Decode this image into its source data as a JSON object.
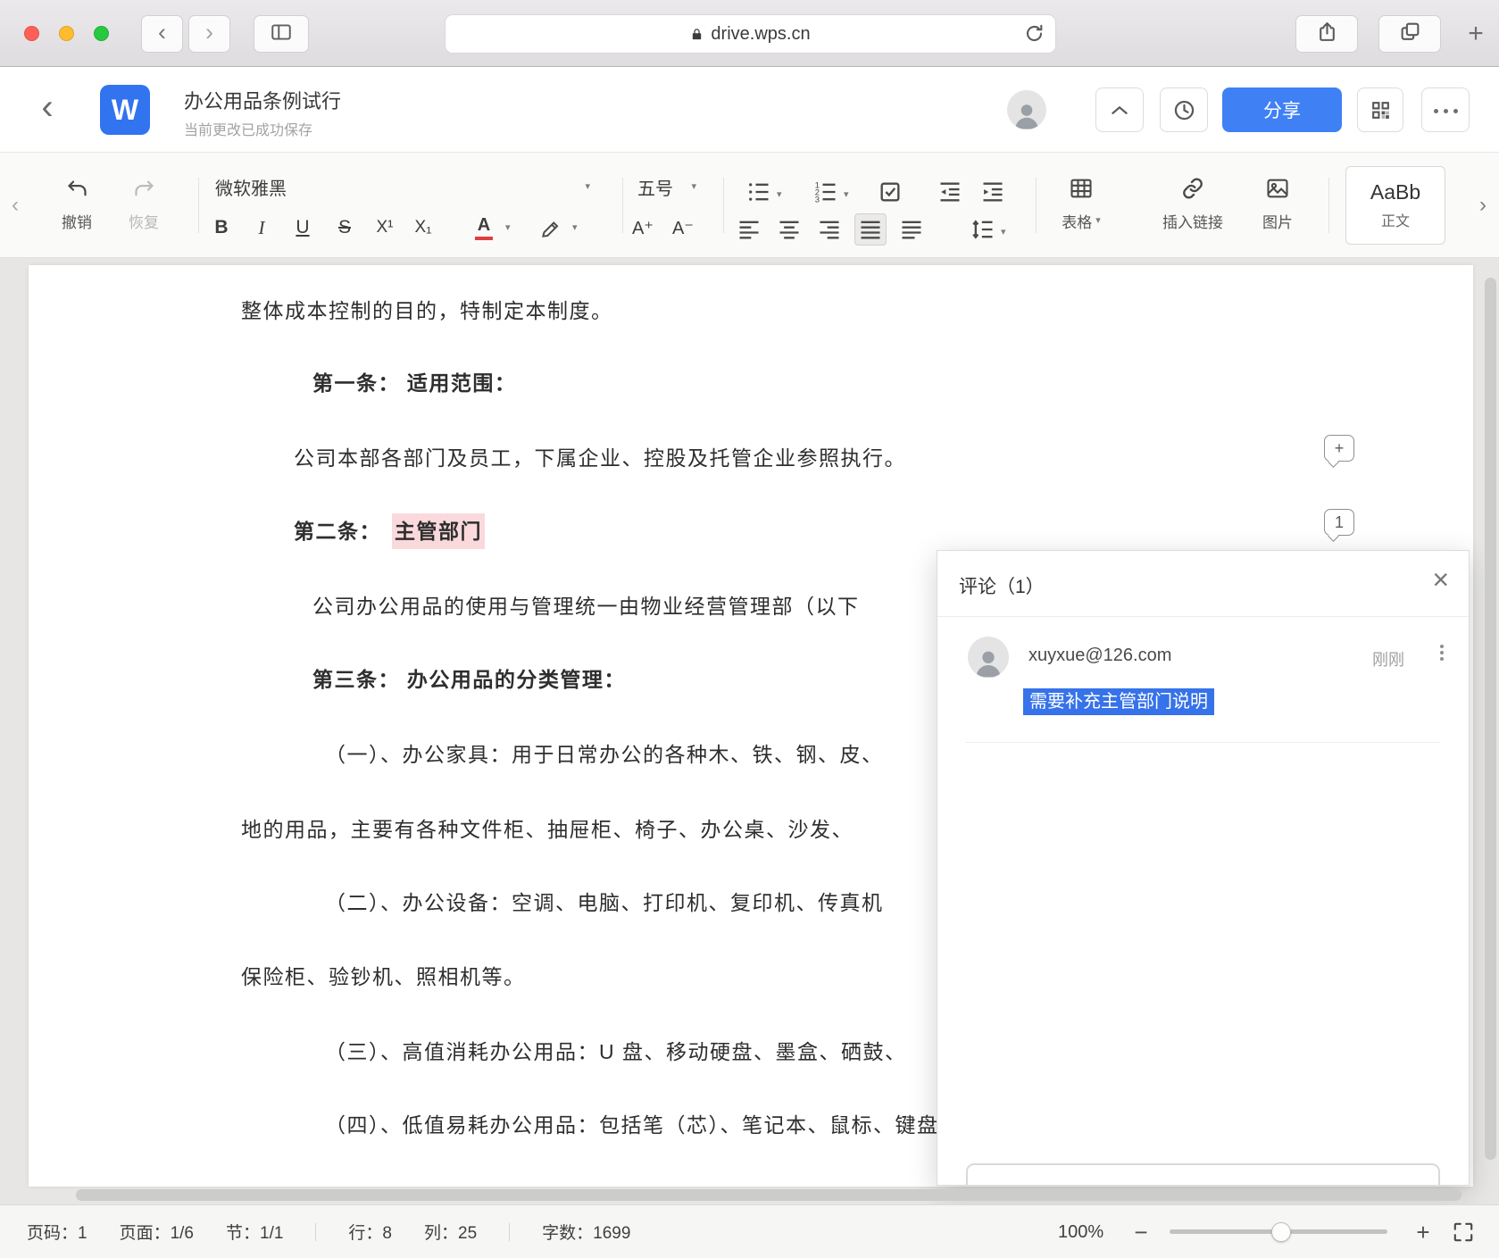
{
  "browser": {
    "url": "drive.wps.cn",
    "back_glyph": "‹",
    "forward_glyph": "›",
    "new_tab_glyph": "+"
  },
  "header": {
    "back_glyph": "‹",
    "logo_letter": "W",
    "title": "办公用品条例试行",
    "save_status": "当前更改已成功保存",
    "share_label": "分享"
  },
  "toolbar": {
    "scroll_left_glyph": "‹",
    "scroll_right_glyph": "›",
    "caret_glyph": "▾",
    "undo_label": "撤销",
    "redo_label": "恢复",
    "font_name": "微软雅黑",
    "font_size": "五号",
    "bold_label": "B",
    "italic_label": "I",
    "underline_label": "U",
    "strikethrough_label": "S",
    "superscript_label": "X¹",
    "subscript_label": "X₁",
    "font_color_label": "A",
    "grow_font_label": "A⁺",
    "shrink_font_label": "A⁻",
    "table_label": "表格",
    "link_label": "插入链接",
    "image_label": "图片",
    "style_sample": "AaBb",
    "style_name": "正文"
  },
  "document": {
    "paragraphs": [
      {
        "text": "整体成本控制的目的，特制定本制度。"
      },
      {
        "text": "第一条： 适用范围："
      },
      {
        "text": "公司本部各部门及员工，下属企业、控股及托管企业参照执行。"
      },
      {
        "prefix": "第二条：",
        "highlight": "主管部门"
      },
      {
        "text": "公司办公用品的使用与管理统一由物业经营管理部（以下"
      },
      {
        "text": "第三条： 办公用品的分类管理："
      },
      {
        "text": "（一）、办公家具：用于日常办公的各种木、铁、钢、皮、"
      },
      {
        "text": "地的用品，主要有各种文件柜、抽屉柜、椅子、办公桌、沙发、"
      },
      {
        "text": "（二）、办公设备：空调、电脑、打印机、复印机、传真机"
      },
      {
        "text": "保险柜、验钞机、照相机等。"
      },
      {
        "text": "（三）、高值消耗办公用品：U 盘、移动硬盘、墨盒、硒鼓、"
      },
      {
        "text": "（四）、低值易耗办公用品：包括笔（芯）、笔记本、鼠标、键盘"
      }
    ],
    "comment_markers": {
      "add_glyph": "+",
      "count": "1"
    }
  },
  "comment_panel": {
    "title": "评论（1）",
    "close_glyph": "×",
    "comment": {
      "author": "xuyxue@126.com",
      "time": "刚刚",
      "text": "需要补充主管部门说明"
    }
  },
  "status_bar": {
    "page_number": "页码：1",
    "page_of": "页面：1/6",
    "section": "节：1/1",
    "line": "行：8",
    "column": "列：25",
    "word_count": "字数：1699",
    "zoom_percent": "100%",
    "zoom_out_glyph": "−",
    "zoom_in_glyph": "+"
  },
  "colors": {
    "accent_blue": "#4080f5",
    "logo_blue": "#3273f0",
    "highlight_pink": "#fad9dc",
    "selection_blue": "#3672e9",
    "traffic_red": "#ff5f57",
    "traffic_yellow": "#febc2e",
    "traffic_green": "#28c840"
  }
}
